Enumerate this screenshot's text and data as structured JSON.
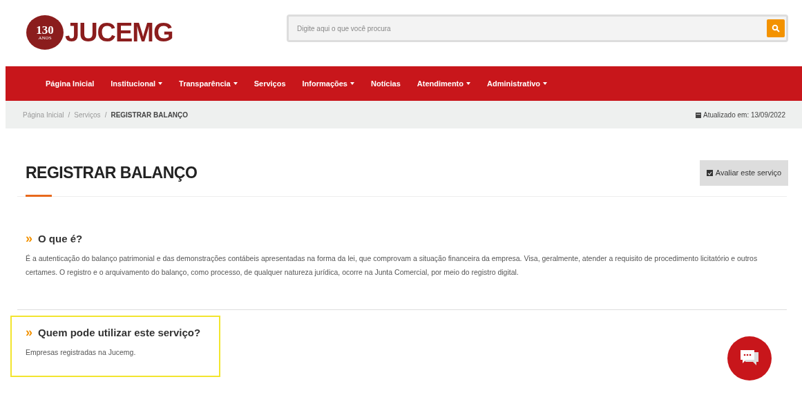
{
  "logo": {
    "badge_number": "130",
    "badge_word": "ANOS",
    "name": "JUCEMG"
  },
  "search": {
    "placeholder": "Digite aqui o que você procura"
  },
  "nav": [
    {
      "label": "Página Inicial",
      "has_menu": false
    },
    {
      "label": "Institucional",
      "has_menu": true
    },
    {
      "label": "Transparência",
      "has_menu": true
    },
    {
      "label": "Serviços",
      "has_menu": false
    },
    {
      "label": "Informações",
      "has_menu": true
    },
    {
      "label": "Notícias",
      "has_menu": false
    },
    {
      "label": "Atendimento",
      "has_menu": true
    },
    {
      "label": "Administrativo",
      "has_menu": true
    }
  ],
  "breadcrumb": [
    {
      "label": "Página Inicial",
      "current": false
    },
    {
      "label": "Serviços",
      "current": false
    },
    {
      "label": "REGISTRAR BALANÇO",
      "current": true
    }
  ],
  "breadcrumb_separator": "/",
  "updated": "Atualizado em: 13/09/2022",
  "title": "REGISTRAR BALANÇO",
  "rate_button": "Avaliar este serviço",
  "sections": [
    {
      "marker": "»",
      "heading": "O que é?",
      "text": "É a autenticação do balanço patrimonial e das demonstrações contábeis apresentadas na forma da lei, que comprovam a situação financeira da empresa. Visa, geralmente, atender a requisito de procedimento licitatório e outros certames. O registro e o arquivamento do balanço, como processo, de qualquer natureza jurídica, ocorre na Junta Comercial, por meio do registro digital.",
      "highlighted": false
    },
    {
      "marker": "»",
      "heading": "Quem pode utilizar este serviço?",
      "text": "Empresas registradas na Jucemg.",
      "highlighted": true
    }
  ]
}
